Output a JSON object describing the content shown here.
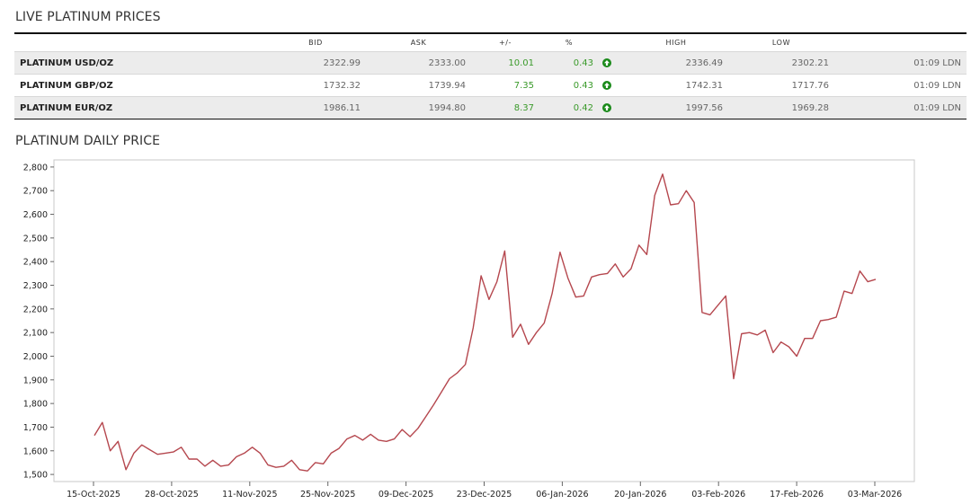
{
  "live": {
    "title": "LIVE PLATINUM PRICES",
    "headers": {
      "bid": "BID",
      "ask": "ASK",
      "change": "+/-",
      "pct": "%",
      "high": "HIGH",
      "low": "LOW"
    },
    "rows": [
      {
        "name": "PLATINUM USD/OZ",
        "bid": "2322.99",
        "ask": "2333.00",
        "change": "10.01",
        "pct": "0.43",
        "high": "2336.49",
        "low": "2302.21",
        "time": "01:09 LDN"
      },
      {
        "name": "PLATINUM GBP/OZ",
        "bid": "1732.32",
        "ask": "1739.94",
        "change": "7.35",
        "pct": "0.43",
        "high": "1742.31",
        "low": "1717.76",
        "time": "01:09 LDN"
      },
      {
        "name": "PLATINUM EUR/OZ",
        "bid": "1986.11",
        "ask": "1994.80",
        "change": "8.37",
        "pct": "0.42",
        "high": "1997.56",
        "low": "1969.28",
        "time": "01:09 LDN"
      }
    ],
    "up_icon": "arrow-up-circle-icon",
    "up_color": "#1a8a1a"
  },
  "daily": {
    "title": "PLATINUM DAILY PRICE"
  },
  "chart_data": {
    "type": "line",
    "title": "",
    "xlabel": "",
    "ylabel": "",
    "ylim": [
      1470,
      2830
    ],
    "yticks": [
      1500,
      1600,
      1700,
      1800,
      1900,
      2000,
      2100,
      2200,
      2300,
      2400,
      2500,
      2600,
      2700,
      2800
    ],
    "yticklabels": [
      "1,500",
      "1,600",
      "1,700",
      "1,800",
      "1,900",
      "2,000",
      "2,100",
      "2,200",
      "2,300",
      "2,400",
      "2,500",
      "2,600",
      "2,700",
      "2,800"
    ],
    "xticklabels": [
      "15-Oct-2025",
      "28-Oct-2025",
      "11-Nov-2025",
      "25-Nov-2025",
      "09-Dec-2025",
      "23-Dec-2025",
      "06-Jan-2026",
      "20-Jan-2026",
      "03-Feb-2026",
      "17-Feb-2026",
      "03-Mar-2026"
    ],
    "line_color": "#b5474e",
    "grid": false,
    "series": [
      {
        "name": "",
        "values": [
          1665,
          1720,
          1600,
          1640,
          1520,
          1590,
          1625,
          1605,
          1585,
          1590,
          1595,
          1615,
          1565,
          1565,
          1535,
          1560,
          1535,
          1540,
          1575,
          1590,
          1615,
          1590,
          1540,
          1530,
          1535,
          1560,
          1520,
          1515,
          1550,
          1545,
          1590,
          1610,
          1650,
          1665,
          1645,
          1670,
          1645,
          1640,
          1650,
          1690,
          1660,
          1695,
          1745,
          1795,
          1850,
          1905,
          1930,
          1965,
          2120,
          2340,
          2240,
          2315,
          2445,
          2080,
          2135,
          2050,
          2100,
          2140,
          2265,
          2440,
          2330,
          2250,
          2255,
          2335,
          2345,
          2350,
          2390,
          2335,
          2370,
          2470,
          2430,
          2680,
          2770,
          2640,
          2645,
          2700,
          2650,
          2185,
          2175,
          2215,
          2255,
          1905,
          2095,
          2100,
          2090,
          2110,
          2015,
          2060,
          2040,
          2000,
          2075,
          2075,
          2150,
          2155,
          2165,
          2275,
          2265,
          2360,
          2315,
          2325
        ]
      }
    ]
  }
}
